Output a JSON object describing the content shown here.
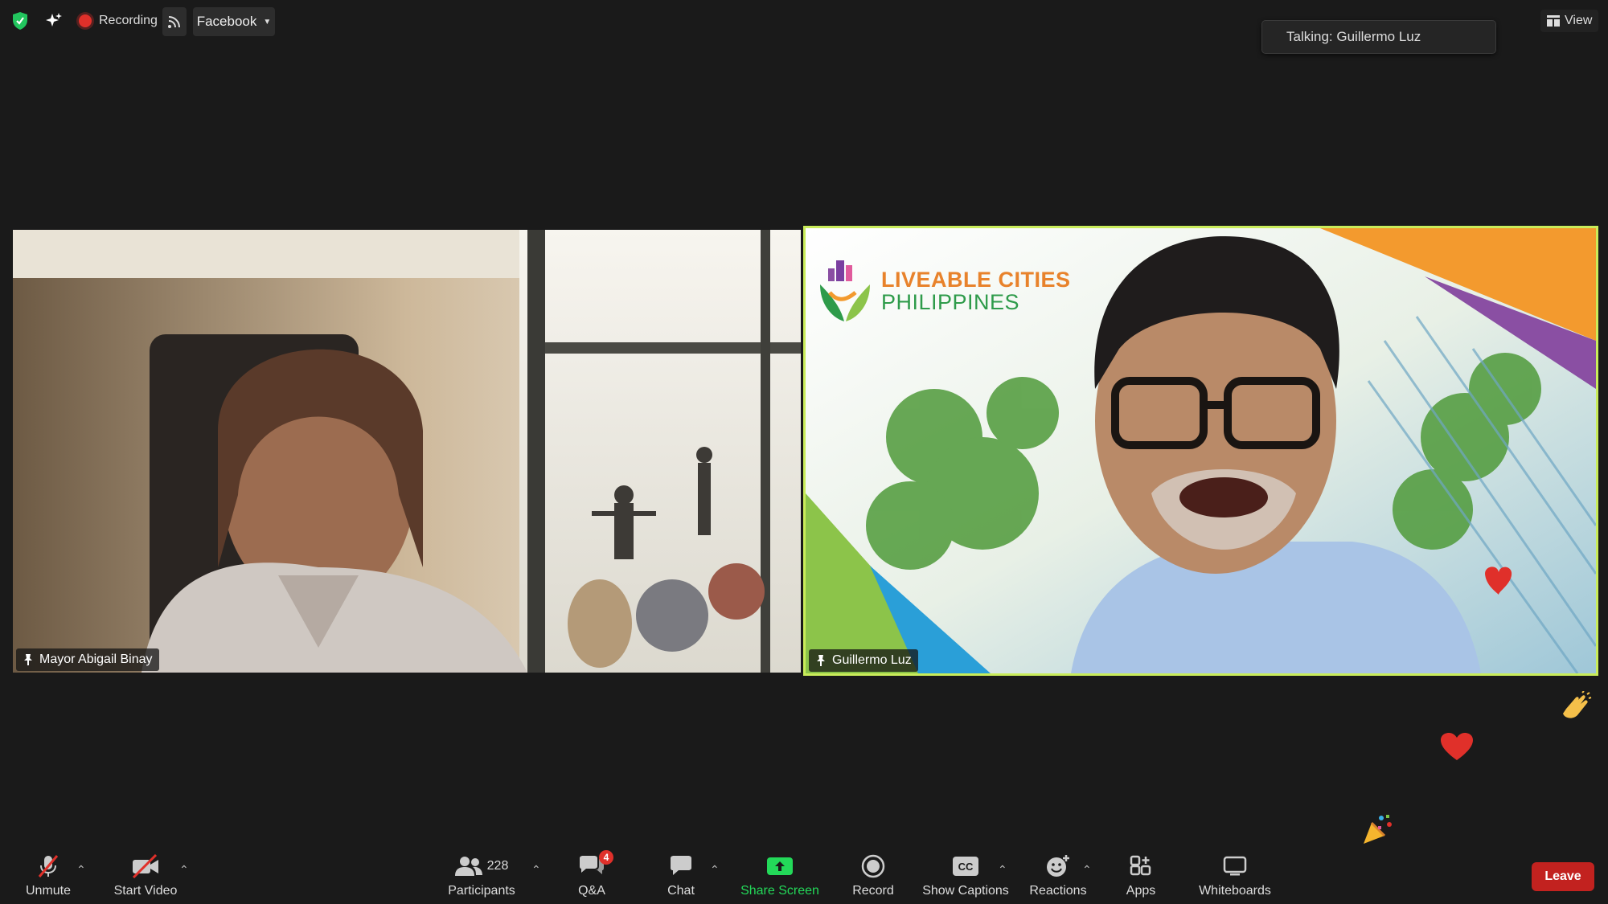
{
  "top_bar": {
    "recording_label": "Recording",
    "stream_target": "Facebook",
    "view_label": "View",
    "talking_label": "Talking: Guillermo Luz"
  },
  "participants": [
    {
      "name": "Mayor Abigail Binay"
    },
    {
      "name": "Guillermo Luz",
      "active_speaker": true
    }
  ],
  "background": {
    "logo_line1": "LIVEABLE CITIES",
    "logo_line2": "PHILIPPINES"
  },
  "toolbar": {
    "unmute": "Unmute",
    "start_video": "Start Video",
    "participants": "Participants",
    "participants_count": "228",
    "qa": "Q&A",
    "qa_badge": "4",
    "chat": "Chat",
    "share_screen": "Share Screen",
    "record": "Record",
    "show_captions": "Show Captions",
    "captions_icon_text": "CC",
    "reactions": "Reactions",
    "apps": "Apps",
    "whiteboards": "Whiteboards",
    "leave": "Leave"
  },
  "colors": {
    "share_green": "#23d959",
    "active_border": "#c9ec5a",
    "leave_red": "#c2221f",
    "badge_red": "#e0302a"
  }
}
